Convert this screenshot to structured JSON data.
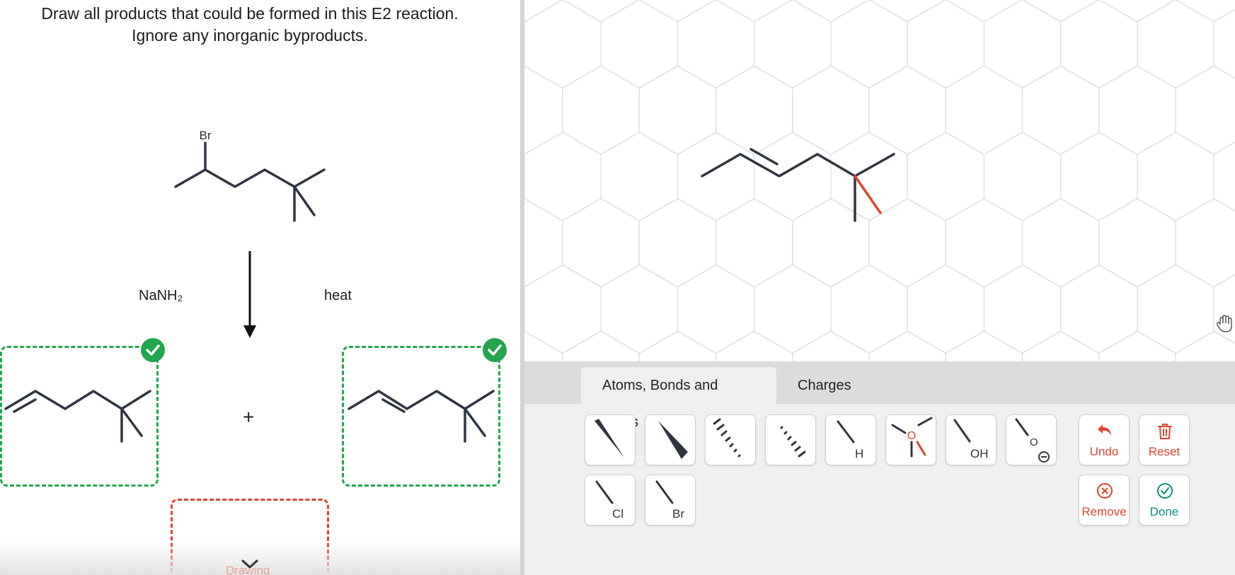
{
  "question": {
    "line1": "Draw all products that could be formed in this E2 reaction.",
    "line2": "Ignore any inorganic byproducts."
  },
  "reactant": {
    "substituent": "Br"
  },
  "conditions": {
    "reagent": "NaNH₂",
    "condition": "heat"
  },
  "products": {
    "plus": "+",
    "answers": [
      {
        "status": "correct"
      },
      {
        "status": "correct"
      },
      {
        "status": "drawing",
        "label": "Drawing"
      }
    ]
  },
  "tabs": [
    {
      "label": "Atoms, Bonds and Rings",
      "active": true
    },
    {
      "label": "Charges",
      "active": false
    }
  ],
  "tools": [
    {
      "icon": "wedge-bond-icon"
    },
    {
      "icon": "bold-wedge-bond-icon"
    },
    {
      "icon": "hash-bond-icon"
    },
    {
      "icon": "hash-bond-alt-icon"
    },
    {
      "icon": "hydrogen-bond-icon",
      "label": "H"
    },
    {
      "icon": "oxygen-template-icon",
      "label": "O"
    },
    {
      "icon": "hydroxyl-icon",
      "label": "OH"
    },
    {
      "icon": "alkoxide-icon",
      "label": "O"
    },
    {
      "icon": "chlorine-icon",
      "label": "Cl"
    },
    {
      "icon": "bromine-icon",
      "label": "Br"
    }
  ],
  "actions": {
    "undo": "Undo",
    "reset": "Reset",
    "remove": "Remove",
    "done": "Done"
  },
  "colors": {
    "correct": "#22a54d",
    "incorrect": "#e34234",
    "highlight": "#e04434",
    "teal": "#0f8d80"
  }
}
